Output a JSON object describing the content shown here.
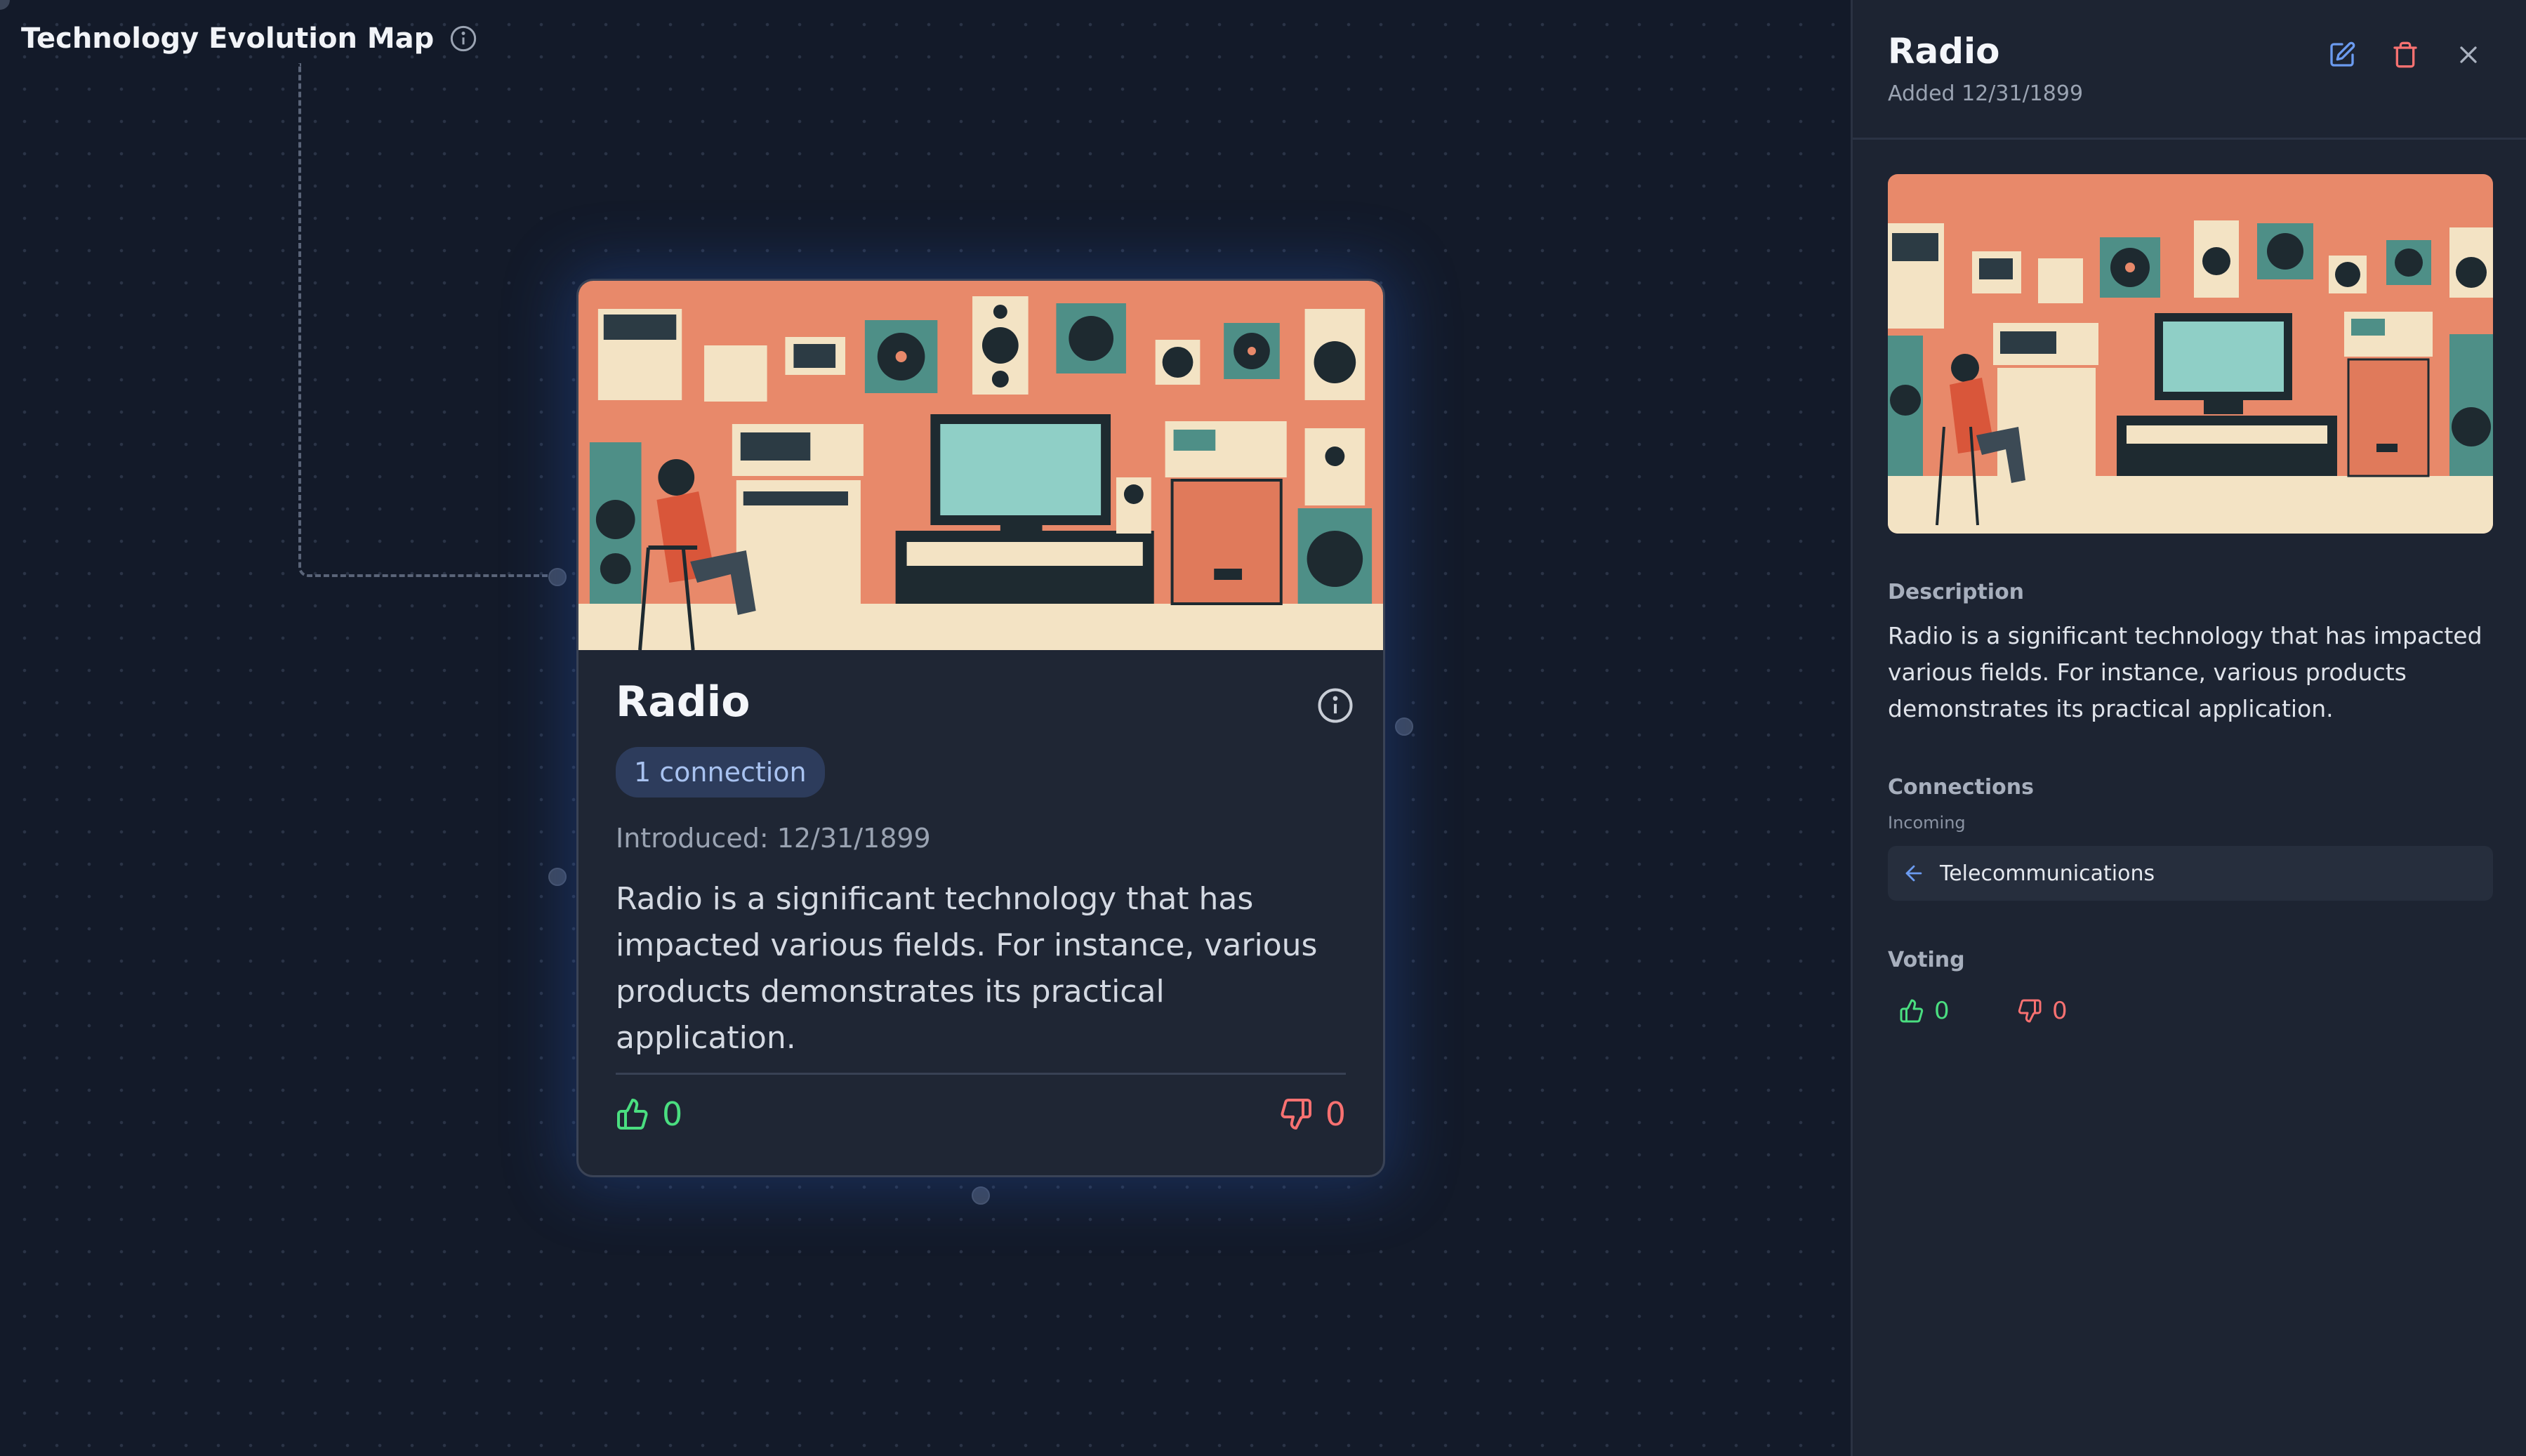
{
  "app": {
    "title": "Technology Evolution Map",
    "info_icon": "info-icon"
  },
  "node": {
    "title": "Radio",
    "connections_badge": "1 connection",
    "introduced": "Introduced: 12/31/1899",
    "description": "Radio is a significant technology that has impacted various fields. For instance, various products demonstrates its practical application.",
    "upvotes": "0",
    "downvotes": "0",
    "image_icon": "retro-electronics-illustration"
  },
  "panel": {
    "title": "Radio",
    "added": "Added 12/31/1899",
    "actions": [
      "edit-icon",
      "trash-icon",
      "close-icon"
    ],
    "description_label": "Description",
    "description": "Radio is a significant technology that has impacted various fields. For instance, various products demonstrates its practical application.",
    "connections_label": "Connections",
    "incoming_label": "Incoming",
    "incoming": [
      {
        "name": "Telecommunications"
      }
    ],
    "voting_label": "Voting",
    "upvotes": "0",
    "downvotes": "0"
  },
  "colors": {
    "canvas_bg": "#131a29",
    "card_bg": "#1f2634",
    "panel_bg": "#1d2432",
    "accent_blue": "#6b9bf0",
    "upvote_green": "#4ade80",
    "downvote_red": "#f87171",
    "illustration_bg": "#e8896a"
  }
}
